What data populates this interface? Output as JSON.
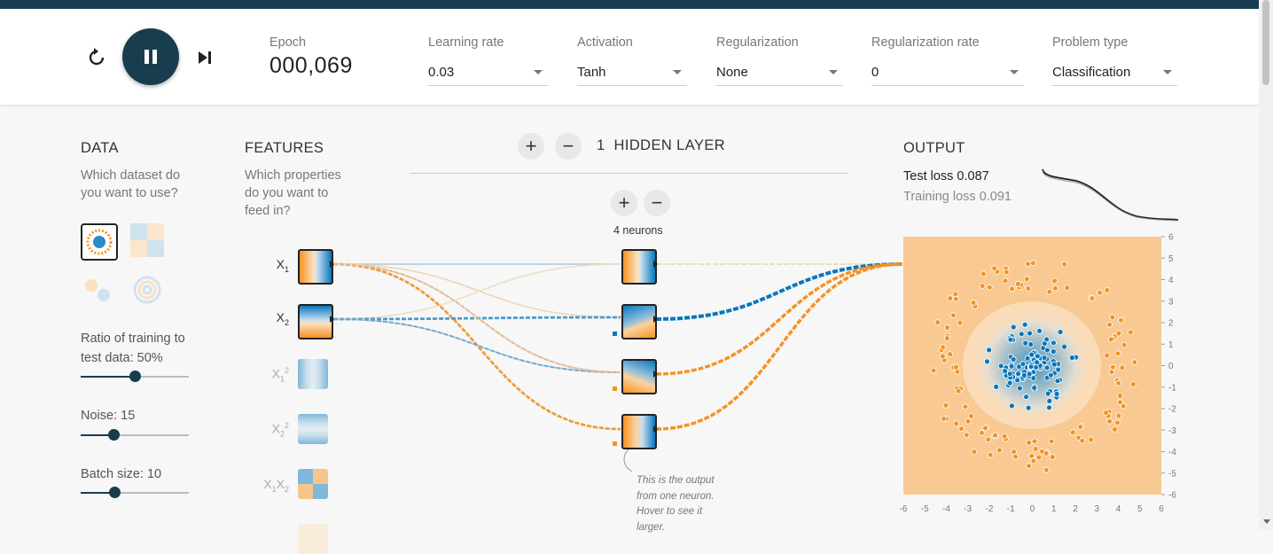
{
  "controls": {
    "reset_icon": "reset-icon",
    "play_icon": "play-pause-icon",
    "step_icon": "step-forward-icon"
  },
  "header": {
    "epoch_label": "Epoch",
    "epoch_value": "000,069",
    "learning_rate": {
      "label": "Learning rate",
      "value": "0.03"
    },
    "activation": {
      "label": "Activation",
      "value": "Tanh"
    },
    "regularization": {
      "label": "Regularization",
      "value": "None"
    },
    "regularization_rate": {
      "label": "Regularization rate",
      "value": "0"
    },
    "problem_type": {
      "label": "Problem type",
      "value": "Classification"
    }
  },
  "data": {
    "title": "DATA",
    "desc_line1": "Which dataset do",
    "desc_line2": "you want to use?",
    "ratio_label_1": "Ratio of training to",
    "ratio_label_2": "test data:  50%",
    "ratio_value": 50,
    "noise_label": "Noise:  15",
    "noise_value": 15,
    "batch_label": "Batch size:  10",
    "batch_value": 10
  },
  "features": {
    "title": "FEATURES",
    "desc_line1": "Which properties",
    "desc_line2": "do you want to",
    "desc_line3": "feed in?",
    "items": [
      {
        "base": "X",
        "sub": "1",
        "sup": ""
      },
      {
        "base": "X",
        "sub": "2",
        "sup": ""
      },
      {
        "base": "X",
        "sub": "1",
        "sup": "2"
      },
      {
        "base": "X",
        "sub": "2",
        "sup": "2"
      },
      {
        "base": "X",
        "sub": "1",
        "sup": "",
        "base2": "X",
        "sub2": "2"
      }
    ]
  },
  "network": {
    "add": "+",
    "remove": "−",
    "hidden_count": "1",
    "hidden_label": "HIDDEN LAYER",
    "neurons_label": "4 neurons",
    "hint_1": "This is the output",
    "hint_2": "from one neuron.",
    "hint_3": "Hover to see it",
    "hint_4": "larger."
  },
  "output": {
    "title": "OUTPUT",
    "test_loss": "Test loss 0.087",
    "training_loss": "Training loss 0.091",
    "y_ticks": [
      "6",
      "5",
      "4",
      "3",
      "2",
      "1",
      "0",
      "-1",
      "-2",
      "-3",
      "-4",
      "-5",
      "-6"
    ],
    "x_ticks": [
      "-6",
      "-5",
      "-4",
      "-3",
      "-2",
      "-1",
      "0",
      "1",
      "2",
      "3",
      "4",
      "5",
      "6"
    ]
  },
  "colors": {
    "positive": "#0877bd",
    "negative": "#f59322",
    "dark": "#183d4e"
  }
}
